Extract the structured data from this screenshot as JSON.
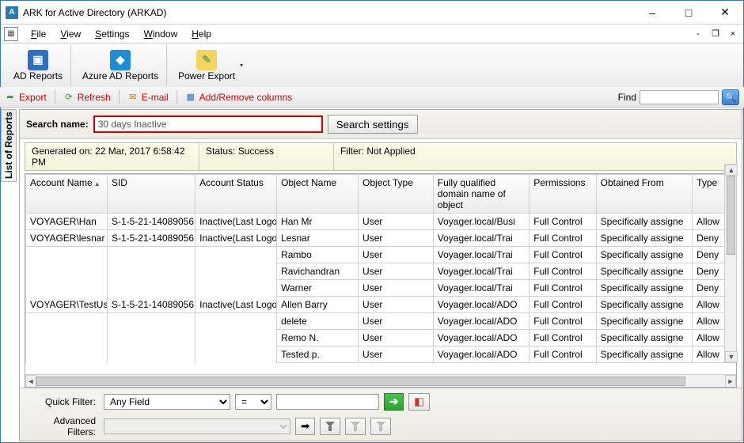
{
  "window": {
    "title": "ARK for Active Directory (ARKAD)"
  },
  "menu": {
    "items": [
      "File",
      "View",
      "Settings",
      "Window",
      "Help"
    ]
  },
  "ribbon": {
    "ad_reports": "AD Reports",
    "azure_reports": "Azure AD Reports",
    "power_export": "Power Export"
  },
  "toolbar": {
    "export": "Export",
    "refresh": "Refresh",
    "email": "E-mail",
    "addremove": "Add/Remove columns",
    "find_label": "Find",
    "find_value": ""
  },
  "sidetab": {
    "label": "List of Reports"
  },
  "search": {
    "label": "Search name:",
    "value": "30 days Inactive",
    "settings_btn": "Search settings"
  },
  "statusbar": {
    "generated_label": "Generated on:",
    "generated_value": "22 Mar, 2017 6:58:42 PM",
    "status_label": "Status:",
    "status_value": "Success",
    "filter_label": "Filter:",
    "filter_value": "Not Applied"
  },
  "grid": {
    "columns": [
      "Account Name",
      "SID",
      "Account Status",
      "Object Name",
      "Object Type",
      "Fully qualified domain name of object",
      "Permissions",
      "Obtained From",
      "Type"
    ],
    "rows": [
      {
        "account": "VOYAGER\\Han",
        "sid": "S-1-5-21-14089056",
        "status": "Inactive(Last Logo",
        "obj": "Han Mr",
        "otype": "User",
        "fqdn": "Voyager.local/Busi",
        "perm": "Full Control",
        "from": "Specifically assigne",
        "type": "Allow"
      },
      {
        "account": "VOYAGER\\lesnar",
        "sid": "S-1-5-21-14089056",
        "status": "Inactive(Last Logo",
        "obj": "Lesnar",
        "otype": "User",
        "fqdn": "Voyager.local/Trai",
        "perm": "Full Control",
        "from": "Specifically assigne",
        "type": "Deny"
      },
      {
        "account": "",
        "sid": "",
        "status": "",
        "obj": "Rambo",
        "otype": "User",
        "fqdn": "Voyager.local/Trai",
        "perm": "Full Control",
        "from": "Specifically assigne",
        "type": "Deny"
      },
      {
        "account": "",
        "sid": "",
        "status": "",
        "obj": "Ravichandran",
        "otype": "User",
        "fqdn": "Voyager.local/Trai",
        "perm": "Full Control",
        "from": "Specifically assigne",
        "type": "Deny"
      },
      {
        "account": "",
        "sid": "",
        "status": "",
        "obj": "Warner",
        "otype": "User",
        "fqdn": "Voyager.local/Trai",
        "perm": "Full Control",
        "from": "Specifically assigne",
        "type": "Deny"
      },
      {
        "account": "VOYAGER\\TestUse",
        "sid": "S-1-5-21-14089056",
        "status": "Inactive(Last Logo",
        "obj": "Allen Barry",
        "otype": "User",
        "fqdn": "Voyager.local/ADO",
        "perm": "Full Control",
        "from": "Specifically assigne",
        "type": "Allow"
      },
      {
        "account": "",
        "sid": "",
        "status": "",
        "obj": "delete",
        "otype": "User",
        "fqdn": "Voyager.local/ADO",
        "perm": "Full Control",
        "from": "Specifically assigne",
        "type": "Allow"
      },
      {
        "account": "",
        "sid": "",
        "status": "",
        "obj": "Remo N.",
        "otype": "User",
        "fqdn": "Voyager.local/ADO",
        "perm": "Full Control",
        "from": "Specifically assigne",
        "type": "Allow"
      },
      {
        "account": "",
        "sid": "",
        "status": "",
        "obj": "Tested p.",
        "otype": "User",
        "fqdn": "Voyager.local/ADO",
        "perm": "Full Control",
        "from": "Specifically assigne",
        "type": "Allow"
      }
    ]
  },
  "quickfilter": {
    "label": "Quick Filter:",
    "field": "Any Field",
    "operator": "=",
    "value": ""
  },
  "advfilter": {
    "label": "Advanced Filters:",
    "value": ""
  }
}
